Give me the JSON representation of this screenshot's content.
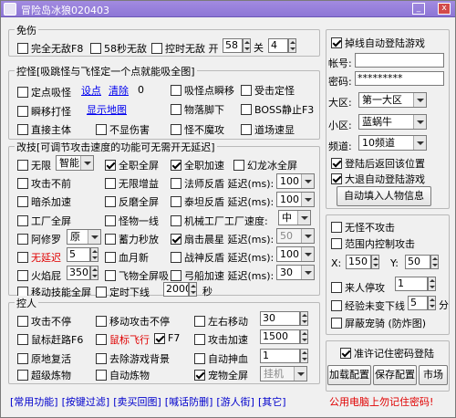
{
  "title": "冒险岛冰狼020403",
  "min_glyph": "_",
  "close_glyph": "x",
  "free": {
    "legend": "免伤",
    "cb1": "完全无敌F8",
    "cb2": "58秒无敌",
    "cb3": "控时无敌 开",
    "on_val": "58",
    "off_label": "关",
    "off_val": "4"
  },
  "monster": {
    "legend": "控怪[吸跳怪与飞怪定一个点就能吸全图]",
    "cb_fix": "定点吸怪",
    "set": "设点",
    "clear": "清除",
    "count": "0",
    "cb_swift": "瞬移打怪",
    "show_map": "显示地图",
    "cb_suck": "吸怪点瞬移",
    "cb_hitfix": "受击定怪",
    "cb_item": "物落脚下",
    "cb_boss": "BOSS静止F3",
    "cb_host": "直接主体",
    "cb_nodmg": "不显伤害",
    "cb_nostrike": "怪不魔攻",
    "cb_terrain": "道场速显"
  },
  "speed": {
    "legend": "改技[可调节攻击速度的功能可无需开无延迟]",
    "c1_1": "无限",
    "mode_sel": "智能",
    "c1_2": "攻击不前",
    "c1_3": "暗杀加速",
    "c1_4": "工厂全屏",
    "c1_5": "阿修罗",
    "c1_5_sel": "原",
    "c1_6": "无延迟",
    "c1_6_val": "5",
    "c1_7": "火焰屁",
    "c1_7_val": "350",
    "c1_8": "移动技能全屏",
    "c2_1": "全职全屏",
    "c2_2": "无限增益",
    "c2_3": "反磨全屏",
    "c2_4": "怪物一线",
    "c2_5": "蓄力秒放",
    "c2_6": "血月新",
    "c2_7": "飞物全屏吸",
    "c2_8": "定时下线",
    "c2_8_val": "2000",
    "c2_8_unit": "秒",
    "c3_1": "全职加速",
    "c3_1b": "幻龙冰全屏",
    "c3_2": "法师反盾 延迟(ms):",
    "c3_2_val": "100",
    "c3_3": "泰坦反盾 延迟(ms):",
    "c3_3_val": "100",
    "c3_4": "机械工厂工厂速度:",
    "c3_4_sel": "中",
    "c3_5": "扇击晨星 延迟(ms):",
    "c3_5_val": "50",
    "c3_6": "战神反盾 延迟(ms):",
    "c3_6_val": "100",
    "c3_7": "弓船加速 延迟(ms):",
    "c3_7_val": "30"
  },
  "control": {
    "legend": "控人",
    "a1": "攻击不停",
    "a2": "鼠标赶路F6",
    "a3": "原地复活",
    "a4": "超级炼物",
    "b1": "移动攻击不停",
    "b2": "鼠标飞行",
    "b2b": "F7",
    "b3": "去除游戏背景",
    "b4": "自动炼物",
    "c1": "左右移动",
    "c1_val": "30",
    "c2": "攻击加速",
    "c2_val": "1500",
    "c3": "自动抻血",
    "c3_val": "1",
    "c4": "宠物全屏",
    "c4_sel": "挂机"
  },
  "right": {
    "auto_login": "掉线自动登陆游戏",
    "account_label": "帐号:",
    "account_val": "",
    "pwd_label": "密码:",
    "pwd_val": "*********",
    "region_label": "大区:",
    "region_val": "第一大区",
    "zone_label": "小区:",
    "zone_val": "蓝蜗牛",
    "channel_label": "频道:",
    "channel_val": "10频道",
    "return_pos": "登陆后返回该位置",
    "exit_login": "大退自动登陆游戏",
    "fill_btn": "自动填入人物信息",
    "no_strike": "无怪不攻击",
    "range_ctrl": "范围内控制攻击",
    "x_label": "X:",
    "x_val": "150",
    "y_label": "Y:",
    "y_val": "50",
    "someone": "来人停攻",
    "someone_val": "1",
    "exp": "经验未变下线",
    "exp_val": "5",
    "exp_unit": "分",
    "dragon": "屏蔽宠骑 (防炸图)",
    "remember": "准许记住密码登陆",
    "load_btn": "加载配置",
    "save_btn": "保存配置",
    "market_btn": "市场",
    "warning": "公用电脑上勿记住密码!"
  },
  "bottom_links": [
    "[常用功能]",
    "[按键过滤]",
    "[卖买回图]",
    "[喊话防删]",
    "[游人街]",
    "[其它]"
  ]
}
